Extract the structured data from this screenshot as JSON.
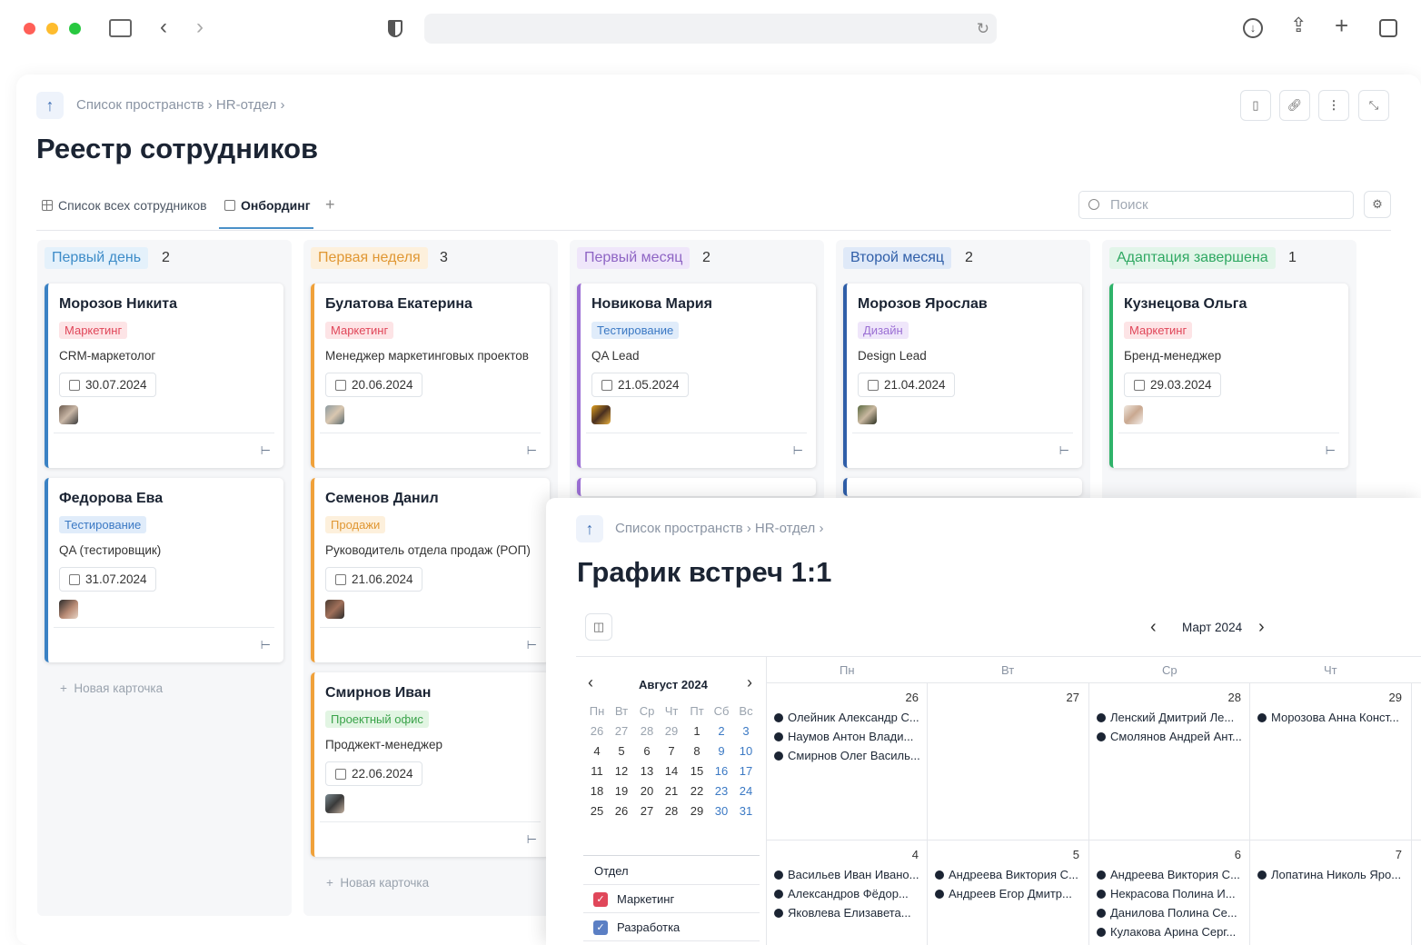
{
  "browser": {
    "colors": {
      "close": "#ff5f57",
      "min": "#febc2e",
      "max": "#28c840"
    }
  },
  "registry": {
    "breadcrumb": [
      "Список пространств",
      "HR-отдел"
    ],
    "title": "Реестр сотрудников",
    "tabs": [
      {
        "label": "Список всех сотрудников",
        "icon": "table-icon"
      },
      {
        "label": "Онбординг",
        "icon": "kanban-icon",
        "active": true
      }
    ],
    "search_placeholder": "Поиск",
    "new_card": "Новая карточка",
    "columns": [
      {
        "title": "Первый день",
        "count": "2",
        "color": "#3b82c4",
        "bg": "#e4f1fb",
        "fg": "#3d8cc8",
        "cards": [
          {
            "name": "Морозов Никита",
            "tag": "Маркетинг",
            "role": "CRM-маркетолог",
            "date": "30.07.2024"
          },
          {
            "name": "Федорова Ева",
            "tag": "Тестирование",
            "role": "QA (тестировщик)",
            "date": "31.07.2024"
          }
        ]
      },
      {
        "title": "Первая неделя",
        "count": "3",
        "color": "#f0a13a",
        "bg": "#fdf0dc",
        "fg": "#e09733",
        "cards": [
          {
            "name": "Булатова Екатерина",
            "tag": "Маркетинг",
            "role": "Менеджер маркетинговых проектов",
            "date": "20.06.2024"
          },
          {
            "name": "Семенов Данил",
            "tag": "Продажи",
            "role": "Руководитель отдела продаж (РОП)",
            "date": "21.06.2024"
          },
          {
            "name": "Смирнов Иван",
            "tag": "Проектный офис",
            "role": "Проджект-менеджер",
            "date": "22.06.2024"
          }
        ]
      },
      {
        "title": "Первый месяц",
        "count": "2",
        "color": "#9b6fd4",
        "bg": "#efe6fa",
        "fg": "#8e64c4",
        "cards": [
          {
            "name": "Новикова Мария",
            "tag": "Тестирование",
            "role": "QA Lead",
            "date": "21.05.2024"
          }
        ]
      },
      {
        "title": "Второй месяц",
        "count": "2",
        "color": "#2f5ea8",
        "bg": "#dfe9f8",
        "fg": "#2f5ea8",
        "cards": [
          {
            "name": "Морозов Ярослав",
            "tag": "Дизайн",
            "role": "Design Lead",
            "date": "21.04.2024"
          }
        ]
      },
      {
        "title": "Адаптация завершена",
        "count": "1",
        "color": "#2fb36a",
        "bg": "#e2f5e9",
        "fg": "#2fa862",
        "cards": [
          {
            "name": "Кузнецова Ольга",
            "tag": "Маркетинг",
            "role": "Бренд-менеджер",
            "date": "29.03.2024"
          }
        ]
      }
    ]
  },
  "tags": {
    "Маркетинг": {
      "bg": "#fde4e6",
      "fg": "#e0475a"
    },
    "Тестирование": {
      "bg": "#e0ecfa",
      "fg": "#3b79c4"
    },
    "Продажи": {
      "bg": "#fdf0dc",
      "fg": "#e09733"
    },
    "Проектный офис": {
      "bg": "#e2f5e3",
      "fg": "#3aa34a"
    },
    "Дизайн": {
      "bg": "#efe6fa",
      "fg": "#9b6fd4"
    }
  },
  "meetings": {
    "breadcrumb": [
      "Список пространств",
      "HR-отдел"
    ],
    "title": "График встреч 1:1",
    "month_nav": "Март 2024",
    "mini_cal": {
      "month": "Август 2024",
      "weekdays": [
        "Пн",
        "Вт",
        "Ср",
        "Чт",
        "Пт",
        "Сб",
        "Вс"
      ],
      "weeks": [
        [
          "26",
          "27",
          "28",
          "29",
          "1",
          "2",
          "3"
        ],
        [
          "4",
          "5",
          "6",
          "7",
          "8",
          "9",
          "10"
        ],
        [
          "11",
          "12",
          "13",
          "14",
          "15",
          "16",
          "17"
        ],
        [
          "18",
          "19",
          "20",
          "21",
          "22",
          "23",
          "24"
        ],
        [
          "25",
          "26",
          "27",
          "28",
          "29",
          "30",
          "31"
        ]
      ]
    },
    "filter_title": "Отдел",
    "filters": [
      {
        "label": "Маркетинг",
        "color": "#e0475a"
      },
      {
        "label": "Разработка",
        "color": "#5b7fc4"
      }
    ],
    "week_headers": [
      "Пн",
      "Вт",
      "Ср",
      "Чт"
    ],
    "week1": [
      {
        "day": "26",
        "events": [
          "Олейник Александр С...",
          "Наумов Антон Влади...",
          "Смирнов Олег Василь..."
        ]
      },
      {
        "day": "27",
        "events": []
      },
      {
        "day": "28",
        "events": [
          "Ленский Дмитрий Ле...",
          "Смолянов Андрей Ант..."
        ]
      },
      {
        "day": "29",
        "events": [
          "Морозова Анна Конст..."
        ]
      }
    ],
    "week2": [
      {
        "day": "4",
        "events": [
          "Васильев Иван Ивано...",
          "Александров Фёдор...",
          "Яковлева Елизавета..."
        ]
      },
      {
        "day": "5",
        "events": [
          "Андреева Виктория С...",
          "Андреев Егор Дмитр..."
        ]
      },
      {
        "day": "6",
        "events": [
          "Андреева Виктория С...",
          "Некрасова Полина И...",
          "Данилова Полина Се...",
          "Кулакова Арина Серг..."
        ]
      },
      {
        "day": "7",
        "events": [
          "Лопатина Николь Яро..."
        ]
      }
    ]
  }
}
